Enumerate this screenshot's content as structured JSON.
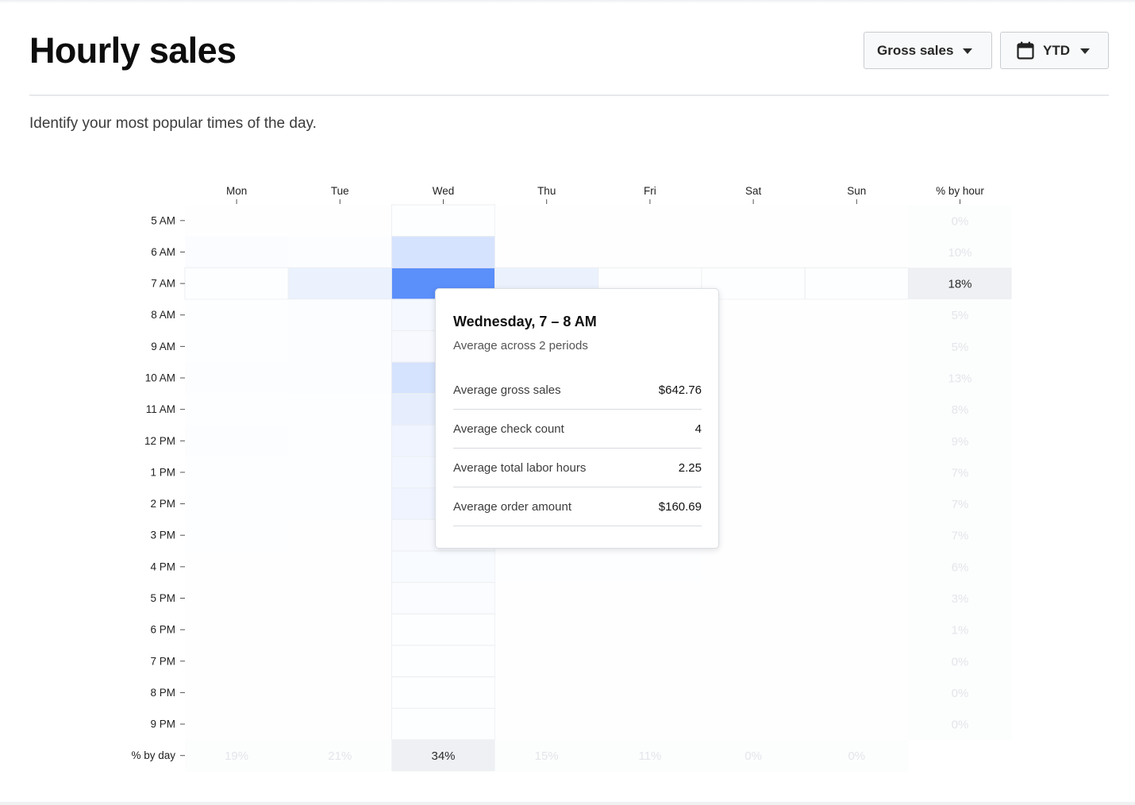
{
  "header": {
    "title": "Hourly sales",
    "subtitle": "Identify your most popular times of the day.",
    "metric_select": "Gross sales",
    "range_select": "YTD",
    "range_icon": "calendar-icon"
  },
  "colors": {
    "accent": "#5b8ffa",
    "cell_max": "#5b8ffa",
    "cell_min": "#ffffff",
    "highlight_bg": "#eef0f3"
  },
  "chart_data": {
    "type": "heatmap",
    "columns": [
      "Mon",
      "Tue",
      "Wed",
      "Thu",
      "Fri",
      "Sat",
      "Sun"
    ],
    "summary_column_label": "% by hour",
    "summary_row_label": "% by day",
    "rows": [
      "5 AM",
      "6 AM",
      "7 AM",
      "8 AM",
      "9 AM",
      "10 AM",
      "11 AM",
      "12 PM",
      "1 PM",
      "2 PM",
      "3 PM",
      "4 PM",
      "5 PM",
      "6 PM",
      "7 PM",
      "8 PM",
      "9 PM"
    ],
    "intensity": [
      [
        0.0,
        0.0,
        0.0,
        0.0,
        0.0,
        0.0,
        0.0
      ],
      [
        0.05,
        0.03,
        0.25,
        0.0,
        0.0,
        0.0,
        0.0
      ],
      [
        0.0,
        0.12,
        1.0,
        0.12,
        0.0,
        0.0,
        0.0
      ],
      [
        0.02,
        0.03,
        0.06,
        0.02,
        0.01,
        0.0,
        0.0
      ],
      [
        0.02,
        0.03,
        0.05,
        0.02,
        0.01,
        0.0,
        0.0
      ],
      [
        0.03,
        0.04,
        0.25,
        0.04,
        0.02,
        0.0,
        0.0
      ],
      [
        0.02,
        0.02,
        0.15,
        0.02,
        0.02,
        0.0,
        0.0
      ],
      [
        0.03,
        0.02,
        0.1,
        0.03,
        0.02,
        0.0,
        0.0
      ],
      [
        0.02,
        0.02,
        0.08,
        0.02,
        0.02,
        0.0,
        0.0
      ],
      [
        0.02,
        0.02,
        0.1,
        0.03,
        0.02,
        0.0,
        0.0
      ],
      [
        0.02,
        0.01,
        0.05,
        0.02,
        0.02,
        0.0,
        0.0
      ],
      [
        0.01,
        0.01,
        0.04,
        0.02,
        0.02,
        0.0,
        0.0
      ],
      [
        0.0,
        0.01,
        0.03,
        0.01,
        0.01,
        0.0,
        0.0
      ],
      [
        0.0,
        0.0,
        0.01,
        0.0,
        0.0,
        0.0,
        0.0
      ],
      [
        0.0,
        0.0,
        0.0,
        0.0,
        0.0,
        0.0,
        0.0
      ],
      [
        0.0,
        0.0,
        0.0,
        0.0,
        0.0,
        0.0,
        0.0
      ],
      [
        0.0,
        0.0,
        0.0,
        0.0,
        0.0,
        0.0,
        0.0
      ]
    ],
    "pct_by_hour": [
      "0%",
      "10%",
      "18%",
      "5%",
      "5%",
      "13%",
      "8%",
      "9%",
      "7%",
      "7%",
      "7%",
      "6%",
      "3%",
      "1%",
      "0%",
      "0%",
      "0%"
    ],
    "pct_by_day": [
      "19%",
      "21%",
      "34%",
      "15%",
      "11%",
      "0%",
      "0%"
    ],
    "highlight": {
      "row": "7 AM",
      "column": "Wed"
    }
  },
  "tooltip": {
    "title": "Wednesday, 7 – 8 AM",
    "subtitle": "Average across 2 periods",
    "rows": [
      {
        "label": "Average gross sales",
        "value": "$642.76"
      },
      {
        "label": "Average check count",
        "value": "4"
      },
      {
        "label": "Average total labor hours",
        "value": "2.25"
      },
      {
        "label": "Average order amount",
        "value": "$160.69"
      }
    ]
  }
}
